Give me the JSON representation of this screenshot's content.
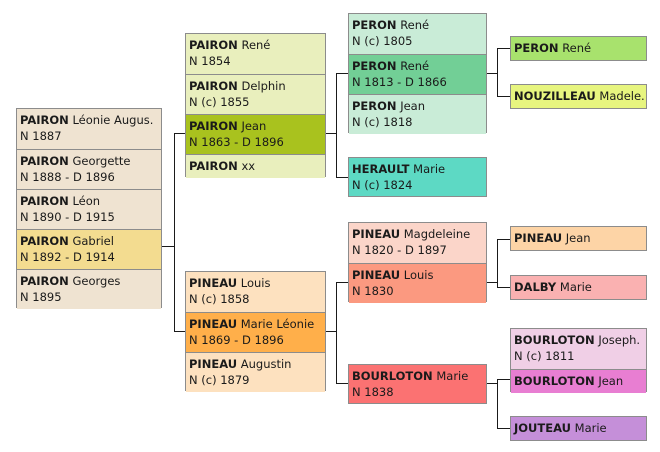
{
  "tree": {
    "gen1": [
      {
        "surname": "PAIRON",
        "given": "Léonie Augus.",
        "dates": "N 1887"
      },
      {
        "surname": "PAIRON",
        "given": "Georgette",
        "dates": "N 1888 - D 1896"
      },
      {
        "surname": "PAIRON",
        "given": "Léon",
        "dates": "N 1890 - D 1915"
      },
      {
        "surname": "PAIRON",
        "given": "Gabriel",
        "dates": "N 1892 - D 1914"
      },
      {
        "surname": "PAIRON",
        "given": "Georges",
        "dates": "N 1895"
      }
    ],
    "gen2_father_group": [
      {
        "surname": "PAIRON",
        "given": "René",
        "dates": "N 1854"
      },
      {
        "surname": "PAIRON",
        "given": "Delphin",
        "dates": "N (c) 1855"
      },
      {
        "surname": "PAIRON",
        "given": "Jean",
        "dates": "N 1863 - D 1896"
      },
      {
        "surname": "PAIRON",
        "given": "xx",
        "dates": ""
      }
    ],
    "gen2_mother_group": [
      {
        "surname": "PINEAU",
        "given": "Louis",
        "dates": "N (c) 1858"
      },
      {
        "surname": "PINEAU",
        "given": "Marie Léonie",
        "dates": "N 1869 - D 1896"
      },
      {
        "surname": "PINEAU",
        "given": "Augustin",
        "dates": "N (c) 1879"
      }
    ],
    "gen3_peron_group": [
      {
        "surname": "PERON",
        "given": "René",
        "dates": "N (c) 1805"
      },
      {
        "surname": "PERON",
        "given": "René",
        "dates": "N 1813 - D 1866"
      },
      {
        "surname": "PERON",
        "given": "Jean",
        "dates": "N (c) 1818"
      }
    ],
    "gen3_herault": {
      "surname": "HERAULT",
      "given": "Marie",
      "dates": "N (c) 1824"
    },
    "gen3_pineau_group": [
      {
        "surname": "PINEAU",
        "given": "Magdeleine",
        "dates": "N 1820 - D 1897"
      },
      {
        "surname": "PINEAU",
        "given": "Louis",
        "dates": "N 1830"
      }
    ],
    "gen3_bourloton": {
      "surname": "BOURLOTON",
      "given": "Marie",
      "dates": "N 1838"
    },
    "gen4_peron": {
      "surname": "PERON",
      "given": "René"
    },
    "gen4_nouzilleau": {
      "surname": "NOUZILLEAU",
      "given": "Madele."
    },
    "gen4_pineau": {
      "surname": "PINEAU",
      "given": "Jean"
    },
    "gen4_dalby": {
      "surname": "DALBY",
      "given": "Marie"
    },
    "gen4_bourloton_group": [
      {
        "surname": "BOURLOTON",
        "given": "Joseph.",
        "dates": "N (c) 1811"
      },
      {
        "surname": "BOURLOTON",
        "given": "Jean",
        "dates": ""
      }
    ],
    "gen4_jouteau": {
      "surname": "JOUTEAU",
      "given": "Marie"
    }
  },
  "colors": {
    "beige": "#efe3d1",
    "gabriel": "#f3dc90",
    "olive_light": "#e9efbd",
    "olive_dark": "#a9c21e",
    "peach_light": "#fde1bf",
    "peach_dark": "#ffaf4a",
    "mint_light": "#c9ecd7",
    "mint_dark": "#72cf96",
    "teal": "#5dd9c4",
    "salmon_light": "#fbd5c9",
    "salmon_dark": "#fb9980",
    "red": "#fb7272",
    "lime": "#a8e26d",
    "yellowgreen": "#e7f57f",
    "peach": "#fdd4a6",
    "pink": "#fab1b1",
    "mauve_light": "#f0cfe6",
    "mauve_dark": "#e87ed2",
    "violet": "#c58fd9"
  }
}
